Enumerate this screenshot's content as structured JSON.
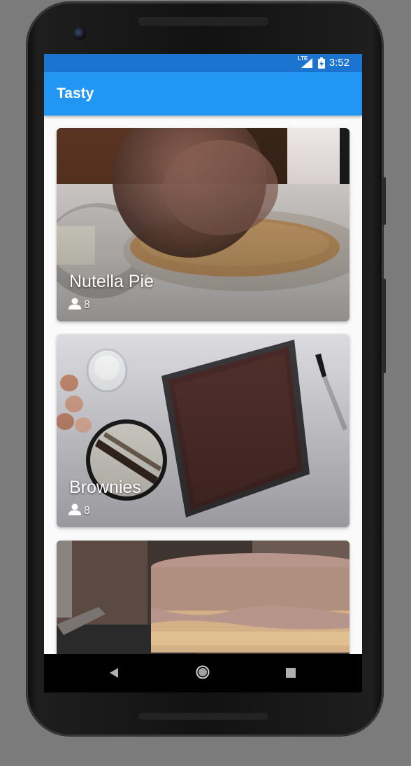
{
  "status_bar": {
    "network": "LTE",
    "time": "3:52",
    "icons": [
      "signal-icon",
      "battery-charging-icon"
    ]
  },
  "app_bar": {
    "title": "Tasty"
  },
  "recipes": [
    {
      "title": "Nutella Pie",
      "servings": "8"
    },
    {
      "title": "Brownies",
      "servings": "8"
    },
    {
      "title": "",
      "servings": ""
    }
  ],
  "nav_bar": {
    "icons": [
      "back-icon",
      "home-icon",
      "recents-icon"
    ]
  },
  "colors": {
    "status_bar": "#1b75d0",
    "app_bar": "#2196f3",
    "content_bg": "#fafafa"
  }
}
